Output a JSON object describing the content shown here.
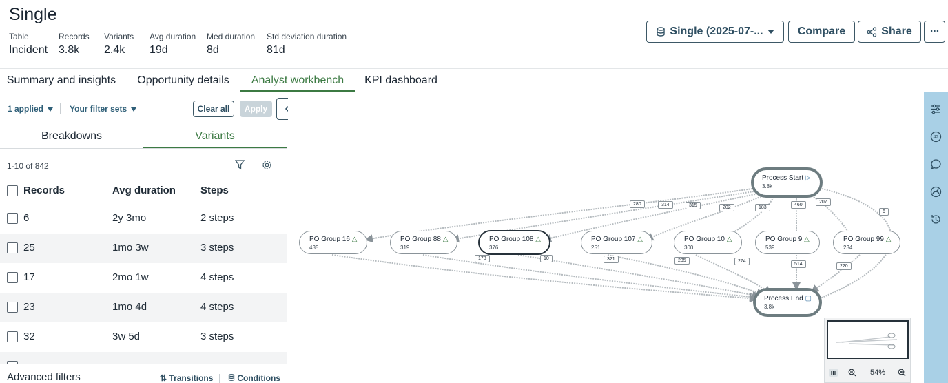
{
  "header": {
    "title": "Single",
    "meta": [
      {
        "label": "Table",
        "value": "Incident"
      },
      {
        "label": "Records",
        "value": "3.8k"
      },
      {
        "label": "Variants",
        "value": "2.4k"
      },
      {
        "label": "Avg duration",
        "value": "19d"
      },
      {
        "label": "Med duration",
        "value": "8d"
      },
      {
        "label": "Std deviation duration",
        "value": "81d"
      }
    ],
    "dataset_button": "Single (2025-07-...",
    "compare_button": "Compare",
    "share_button": "Share",
    "more_button": "..."
  },
  "tabs": [
    "Summary and insights",
    "Opportunity details",
    "Analyst workbench",
    "KPI dashboard"
  ],
  "active_tab": "Analyst workbench",
  "filters": {
    "applied": "1 applied",
    "filter_sets": "Your filter sets",
    "clear_all": "Clear all",
    "apply": "Apply"
  },
  "subtabs": [
    "Breakdowns",
    "Variants"
  ],
  "active_subtab": "Variants",
  "list": {
    "count": "1-10 of 842",
    "headers": [
      "Records",
      "Avg duration",
      "Steps"
    ],
    "rows": [
      {
        "records": "6",
        "avg": "2y 3mo",
        "steps": "2 steps"
      },
      {
        "records": "25",
        "avg": "1mo 3w",
        "steps": "3 steps"
      },
      {
        "records": "17",
        "avg": "2mo 1w",
        "steps": "4 steps"
      },
      {
        "records": "23",
        "avg": "1mo 4d",
        "steps": "4 steps"
      },
      {
        "records": "32",
        "avg": "3w 5d",
        "steps": "3 steps"
      }
    ]
  },
  "advanced": {
    "label": "Advanced filters",
    "transitions": "Transitions",
    "conditions": "Conditions"
  },
  "graph": {
    "start": {
      "name": "Process Start",
      "count": "3.8k"
    },
    "end": {
      "name": "Process End",
      "count": "3.8k"
    },
    "nodes": [
      {
        "name": "PO Group 16",
        "count": "435"
      },
      {
        "name": "PO Group 88",
        "count": "319"
      },
      {
        "name": "PO Group 108",
        "count": "376"
      },
      {
        "name": "PO Group 107",
        "count": "251"
      },
      {
        "name": "PO Group 10",
        "count": "300"
      },
      {
        "name": "PO Group 9",
        "count": "539"
      },
      {
        "name": "PO Group 99",
        "count": "234"
      }
    ],
    "edge_labels": [
      "280",
      "314",
      "315",
      "202",
      "183",
      "460",
      "207",
      "6",
      "178",
      "10",
      "321",
      "235",
      "274",
      "514",
      "220"
    ]
  },
  "zoom": "54%",
  "colors": {
    "accent": "#3c7a43",
    "button_text": "#2f4f62",
    "sidebar": "#a9d0e6"
  }
}
